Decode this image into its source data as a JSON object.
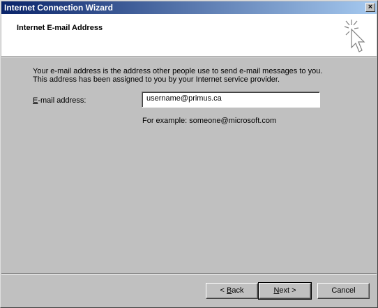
{
  "window": {
    "title": "Internet Connection Wizard",
    "close_label": "×"
  },
  "header": {
    "heading": "Internet E-mail Address"
  },
  "body": {
    "intro_line1": "Your e-mail address is the address other people use to send e-mail messages to you.",
    "intro_line2": "This address has been assigned to you by your Internet service provider.",
    "email_label_mnemonic": "E",
    "email_label_rest": "-mail address:",
    "email_value": "username@primus.ca",
    "example_text": "For example: someone@microsoft.com"
  },
  "buttons": {
    "back_prefix": "< ",
    "back_mnemonic": "B",
    "back_rest": "ack",
    "next_mnemonic": "N",
    "next_rest": "ext >",
    "cancel": "Cancel"
  },
  "icons": {
    "wizard": "wand-cursor-icon",
    "close": "close-icon"
  }
}
